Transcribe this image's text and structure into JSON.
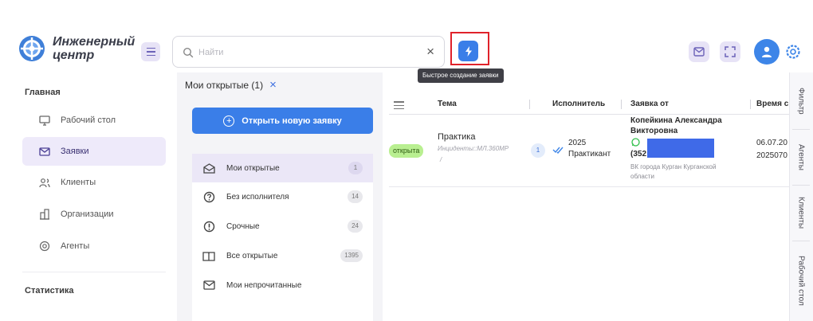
{
  "header": {
    "logo_line1": "Инженерный",
    "logo_line2": "центр",
    "search_placeholder": "Найти",
    "search_clear": "×",
    "quick_create_tooltip": "Быстрое создание заявки"
  },
  "sidebar": {
    "section_main": "Главная",
    "items": [
      {
        "label": "Рабочий стол",
        "icon": "monitor-icon"
      },
      {
        "label": "Заявки",
        "icon": "envelope-icon"
      },
      {
        "label": "Клиенты",
        "icon": "users-icon"
      },
      {
        "label": "Организации",
        "icon": "building-icon"
      },
      {
        "label": "Агенты",
        "icon": "agent-icon"
      }
    ],
    "section_stats": "Статистика"
  },
  "middle": {
    "title": "Мои открытые (1)",
    "close": "×",
    "open_new_label": "Открыть новую заявку",
    "lists": [
      {
        "label": "Мои открытые",
        "count": "1",
        "icon": "envelope-open-icon"
      },
      {
        "label": "Без исполнителя",
        "count": "14",
        "icon": "question-icon"
      },
      {
        "label": "Срочные",
        "count": "24",
        "icon": "exclamation-icon"
      },
      {
        "label": "Все открытые",
        "count": "1395",
        "icon": "book-icon"
      },
      {
        "label": "Мои непрочитанные",
        "count": "",
        "icon": "envelope-icon"
      }
    ]
  },
  "table": {
    "columns": [
      "Тема",
      "Исполнитель",
      "Заявка от",
      "Время с"
    ],
    "row": {
      "status": "открыта",
      "subject": "Практика",
      "subject_sub_line1": "Инциденты::МЛ.360МР",
      "subject_sub_line2": "/",
      "count": "1",
      "executor_line1": "2025",
      "executor_line2": "Практикант",
      "from_name_line1": "Копейкина Александра",
      "from_name_line2": "Викторовна",
      "from_phone": "(352",
      "from_org_line1": "ВК города Курган Курганской",
      "from_org_line2": "области",
      "time_line1": "06.07.20",
      "time_line2": "2025070"
    }
  },
  "right_tabs": [
    "Фильтр",
    "Агенты",
    "Клиенты",
    "Рабочий стол"
  ],
  "colors": {
    "accent": "#3a7ee8",
    "active_bg": "#eeeafa",
    "status_open": "#b9ef91",
    "highlight": "#e0222a"
  }
}
